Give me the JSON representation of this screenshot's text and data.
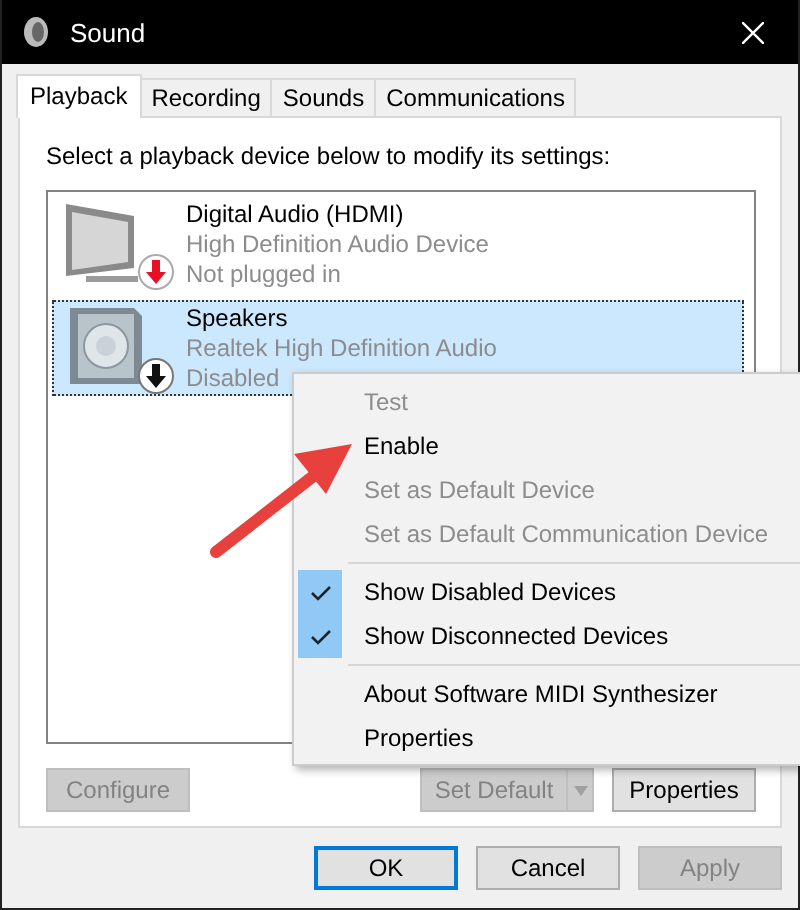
{
  "window": {
    "title": "Sound"
  },
  "tabs": [
    {
      "label": "Playback",
      "selected": true
    },
    {
      "label": "Recording",
      "selected": false
    },
    {
      "label": "Sounds",
      "selected": false
    },
    {
      "label": "Communications",
      "selected": false
    }
  ],
  "instruction": "Select a playback device below to modify its settings:",
  "devices": [
    {
      "kind": "monitor",
      "disabled": false,
      "name": "Digital Audio (HDMI)",
      "driver": "High Definition Audio Device",
      "status": "Not plugged in",
      "selected": false
    },
    {
      "kind": "speaker",
      "disabled": true,
      "name": "Speakers",
      "driver": "Realtek High Definition Audio",
      "status": "Disabled",
      "selected": true
    }
  ],
  "context_menu": [
    {
      "kind": "item",
      "label": "Test",
      "disabled": true,
      "checked": false
    },
    {
      "kind": "item",
      "label": "Enable",
      "disabled": false,
      "checked": false
    },
    {
      "kind": "item",
      "label": "Set as Default Device",
      "disabled": true,
      "checked": false
    },
    {
      "kind": "item",
      "label": "Set as Default Communication Device",
      "disabled": true,
      "checked": false
    },
    {
      "kind": "separator"
    },
    {
      "kind": "item",
      "label": "Show Disabled Devices",
      "disabled": false,
      "checked": true
    },
    {
      "kind": "item",
      "label": "Show Disconnected Devices",
      "disabled": false,
      "checked": true
    },
    {
      "kind": "separator"
    },
    {
      "kind": "item",
      "label": "About Software MIDI Synthesizer",
      "disabled": false,
      "checked": false
    },
    {
      "kind": "item",
      "label": "Properties",
      "disabled": false,
      "checked": false
    }
  ],
  "panel_buttons": [
    {
      "kind": "plain",
      "label": "Configure",
      "disabled": true
    },
    {
      "kind": "split",
      "label": "Set Default",
      "disabled": true
    },
    {
      "kind": "plain",
      "label": "Properties",
      "disabled": false
    }
  ],
  "dialog_buttons": [
    {
      "label": "OK",
      "disabled": false,
      "default": true
    },
    {
      "label": "Cancel",
      "disabled": false,
      "default": false
    },
    {
      "label": "Apply",
      "disabled": true,
      "default": false
    }
  ]
}
